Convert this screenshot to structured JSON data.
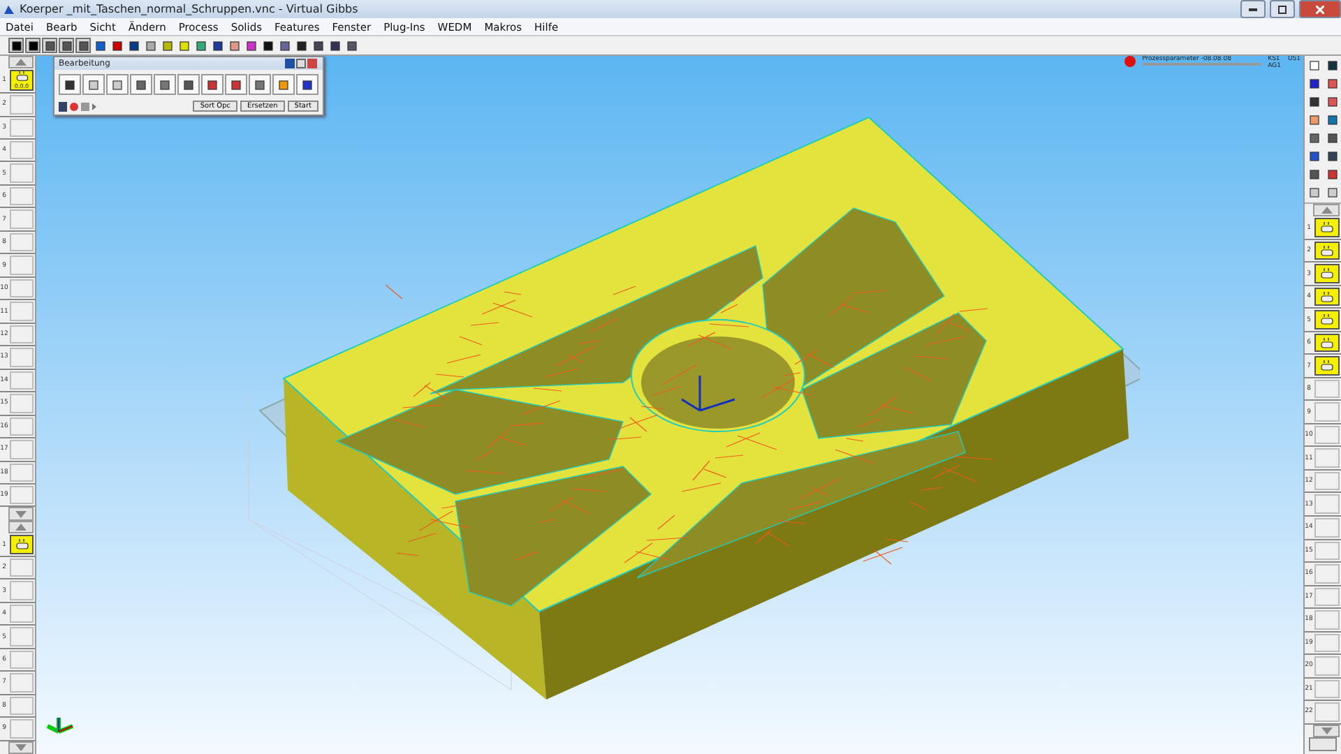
{
  "window": {
    "title": "Koerper _mit_Taschen_normal_Schruppen.vnc - Virtual Gibbs"
  },
  "menu": [
    "Datei",
    "Bearb",
    "Sicht",
    "Ändern",
    "Process",
    "Solids",
    "Features",
    "Fenster",
    "Plug-Ins",
    "WEDM",
    "Makros",
    "Hilfe"
  ],
  "toolbar": {
    "pressed": [
      true,
      true,
      true,
      true,
      true,
      false,
      false,
      false,
      false,
      false,
      false,
      false,
      false,
      false,
      false,
      false,
      false,
      false,
      false,
      false,
      false
    ]
  },
  "status": {
    "process": "Prozessparameter -08.08.08",
    "ks": "KS1",
    "us": "US1",
    "ag": "AG1"
  },
  "palette": {
    "title": "Bearbeitung",
    "buttons": [
      "Sort Opc",
      "Ersetzen",
      "Start"
    ]
  },
  "left_slots": [
    {
      "number": "1",
      "filled": true,
      "caption": "0.0.0"
    },
    {
      "number": "2",
      "filled": false
    },
    {
      "number": "3",
      "filled": false
    },
    {
      "number": "4",
      "filled": false
    },
    {
      "number": "5",
      "filled": false
    },
    {
      "number": "6",
      "filled": false
    },
    {
      "number": "7",
      "filled": false
    },
    {
      "number": "8",
      "filled": false
    },
    {
      "number": "9",
      "filled": false
    },
    {
      "number": "10",
      "filled": false
    },
    {
      "number": "11",
      "filled": false
    },
    {
      "number": "12",
      "filled": false
    },
    {
      "number": "13",
      "filled": false
    },
    {
      "number": "14",
      "filled": false
    },
    {
      "number": "15",
      "filled": false
    },
    {
      "number": "16",
      "filled": false
    },
    {
      "number": "17",
      "filled": false
    },
    {
      "number": "18",
      "filled": false
    },
    {
      "number": "19",
      "filled": false
    }
  ],
  "left_slots_2": [
    {
      "number": "1",
      "filled": true
    },
    {
      "number": "2",
      "filled": false
    },
    {
      "number": "3",
      "filled": false
    },
    {
      "number": "4",
      "filled": false
    },
    {
      "number": "5",
      "filled": false
    },
    {
      "number": "6",
      "filled": false
    },
    {
      "number": "7",
      "filled": false
    },
    {
      "number": "8",
      "filled": false
    },
    {
      "number": "9",
      "filled": false
    }
  ],
  "right_slots": [
    {
      "number": "1",
      "filled": true
    },
    {
      "number": "2",
      "filled": true
    },
    {
      "number": "3",
      "filled": true
    },
    {
      "number": "4",
      "filled": true
    },
    {
      "number": "5",
      "filled": true
    },
    {
      "number": "6",
      "filled": true
    },
    {
      "number": "7",
      "filled": true
    },
    {
      "number": "8",
      "filled": false
    },
    {
      "number": "9",
      "filled": false
    },
    {
      "number": "10",
      "filled": false
    },
    {
      "number": "11",
      "filled": false
    },
    {
      "number": "12",
      "filled": false
    },
    {
      "number": "13",
      "filled": false
    },
    {
      "number": "14",
      "filled": false
    },
    {
      "number": "15",
      "filled": false
    },
    {
      "number": "16",
      "filled": false
    },
    {
      "number": "17",
      "filled": false
    },
    {
      "number": "18",
      "filled": false
    },
    {
      "number": "19",
      "filled": false
    },
    {
      "number": "20",
      "filled": false
    },
    {
      "number": "21",
      "filled": false
    },
    {
      "number": "22",
      "filled": false
    }
  ]
}
